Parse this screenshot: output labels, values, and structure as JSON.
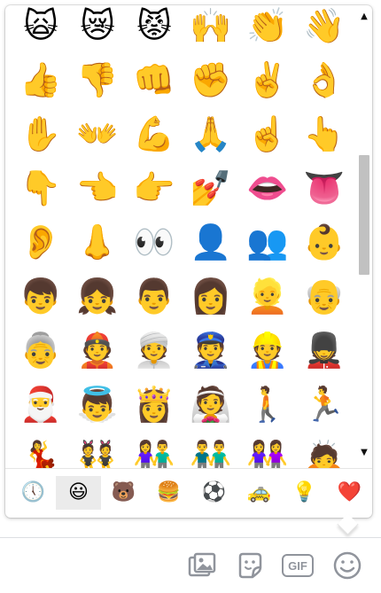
{
  "emoji_picker": {
    "emojis": [
      "🙀",
      "😿",
      "😾",
      "🙌",
      "👏",
      "👋",
      "👍",
      "👎",
      "👊",
      "✊",
      "✌️",
      "👌",
      "✋",
      "👐",
      "💪",
      "🙏",
      "☝️",
      "👆",
      "👇",
      "👈",
      "👉",
      "💅",
      "👄",
      "👅",
      "👂",
      "👃",
      "👀",
      "👤",
      "👥",
      "👶",
      "👦",
      "👧",
      "👨",
      "👩",
      "👱",
      "👴",
      "👵",
      "👲",
      "👳",
      "👮",
      "👷",
      "💂",
      "🎅",
      "👼",
      "👸",
      "👰",
      "🚶",
      "🏃",
      "💃",
      "👯",
      "👫",
      "👬",
      "👭",
      "🙇"
    ],
    "scroll_up_symbol": "▲",
    "scroll_down_symbol": "▼",
    "scroll_position": 0.43,
    "categories": [
      {
        "name": "recent",
        "icon": "🕔"
      },
      {
        "name": "people",
        "icon": "😃"
      },
      {
        "name": "nature",
        "icon": "🐻"
      },
      {
        "name": "food",
        "icon": "🍔"
      },
      {
        "name": "activity",
        "icon": "⚽"
      },
      {
        "name": "travel",
        "icon": "🚕"
      },
      {
        "name": "objects",
        "icon": "💡"
      },
      {
        "name": "symbols",
        "icon": "❤️"
      }
    ],
    "active_category": "people"
  },
  "composer": {
    "gif_label": "GIF",
    "icons": [
      "photo-icon",
      "sticker-icon",
      "gif-icon",
      "emoji-icon"
    ]
  },
  "colors": {
    "icon_gray": "#90949c",
    "active_tab_bg": "#ebebeb",
    "scrollbar_thumb": "#c1c1c1"
  }
}
